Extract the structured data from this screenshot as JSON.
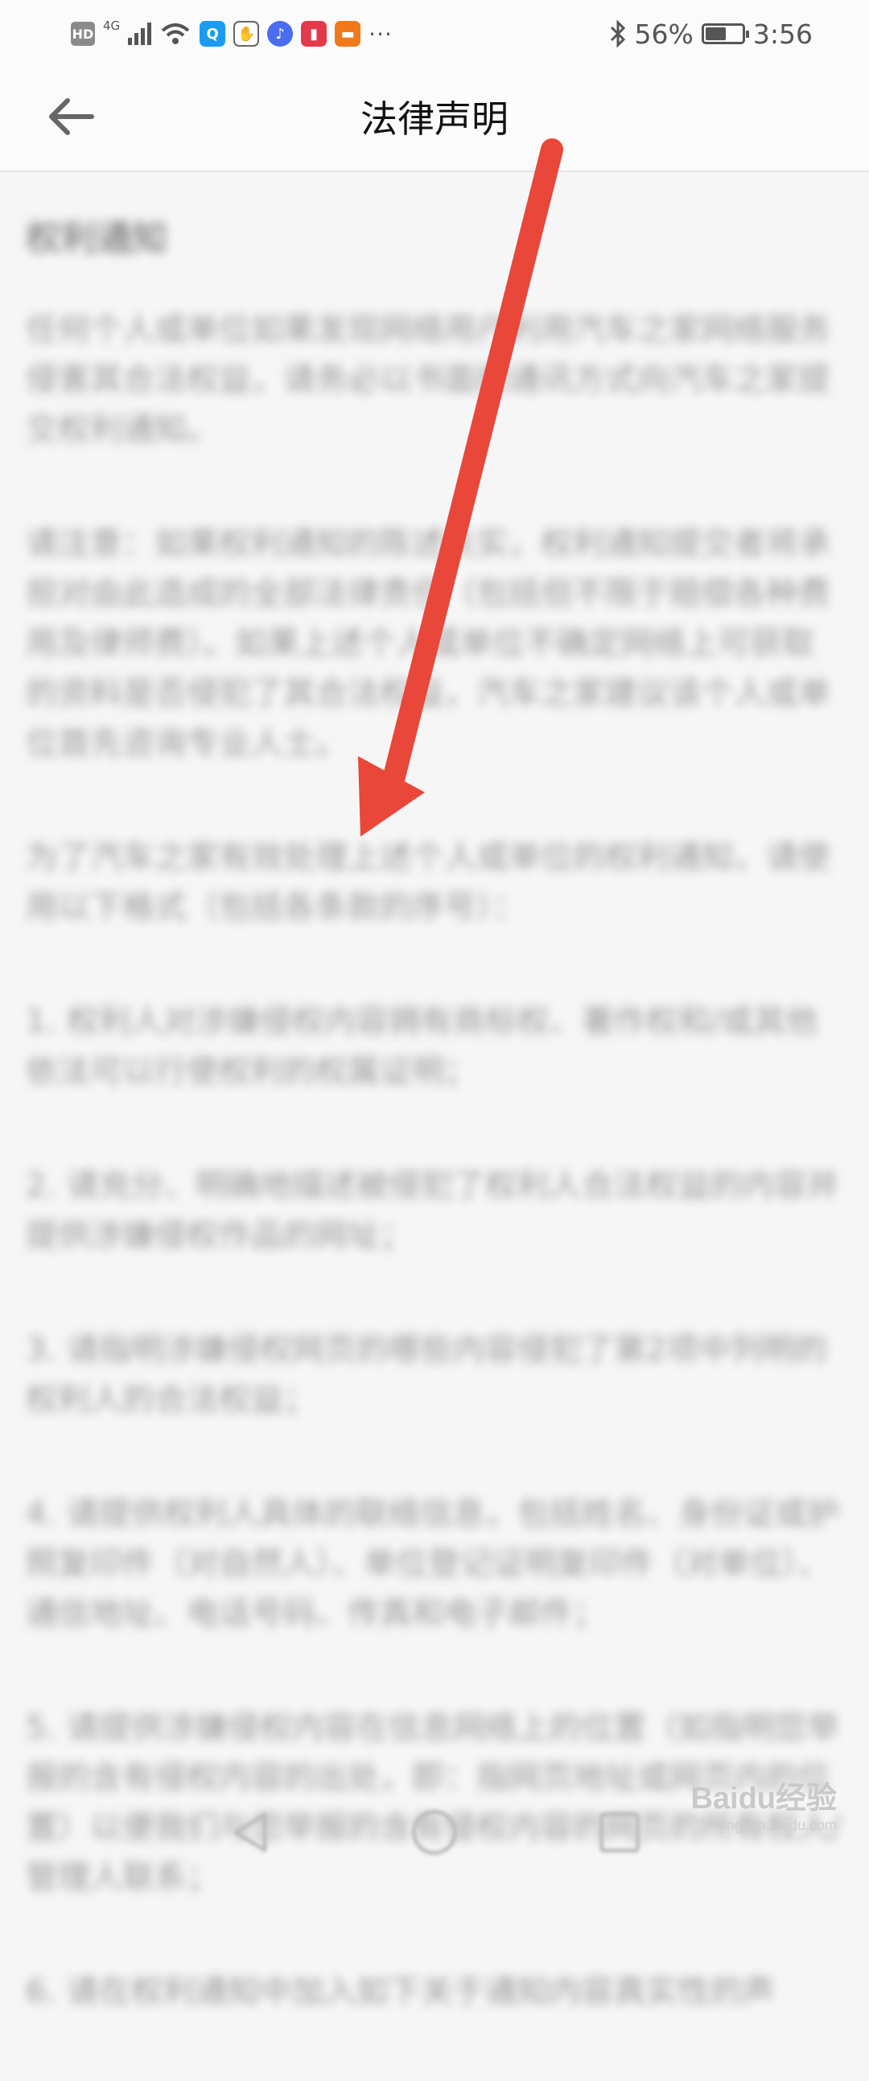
{
  "status_bar": {
    "hd": "HD",
    "network": "4G",
    "battery_percent": "56%",
    "battery_level": 0.56,
    "time": "3:56",
    "more": "···",
    "icons": [
      "signal-icon",
      "wifi-icon",
      "search-app-icon",
      "hand-app-icon",
      "music-app-icon",
      "book-app-icon",
      "news-app-icon",
      "bluetooth-icon",
      "battery-icon"
    ]
  },
  "header": {
    "title": "法律声明",
    "back_icon": "back-arrow-icon"
  },
  "content": {
    "heading": "权利通知",
    "paragraphs": [
      "任何个人或单位如果发现网络用户利用汽车之家网络服务侵害其合法权益，请务必以书面的通讯方式向汽车之家提交权利通知。",
      "请注意：如果权利通知的陈述失实，权利通知提交者将承担对由此造成的全部法律责任（包括但不限于赔偿各种费用及律师费）。如果上述个人或单位不确定网络上可获取的资料是否侵犯了其合法权益，汽车之家建议该个人或单位首先咨询专业人士。",
      "为了汽车之家有效处理上述个人或单位的权利通知，请使用以下格式（包括各条款的序号）：",
      "1. 权利人对涉嫌侵权内容拥有商标权、著作权和/或其他依法可以行使权利的权属证明；",
      "2. 请充分、明确地描述被侵犯了权利人合法权益的内容并提供涉嫌侵权作品的网址；",
      "3. 请指明涉嫌侵权网页的哪些内容侵犯了第2项中列明的权利人的合法权益；",
      "4. 请提供权利人具体的联络信息，包括姓名、身份证或护照复印件（对自然人）、单位登记证明复印件（对单位）、通信地址、电话号码、传真和电子邮件；",
      "5. 请提供涉嫌侵权内容在信息网络上的位置（如指明您举报的含有侵权内容的出处，即：指网页地址或网页内的位置）以便我们与您举报的含有侵权内容的网页的所有权人/管理人联系；",
      "6. 请在权利通知中加入如下关于通知内容真实性的声"
    ]
  },
  "nav_bar": {
    "back": "triangle-back-icon",
    "home": "circle-home-icon",
    "recent": "square-recent-icon"
  },
  "watermark": {
    "text": "Baidu经验",
    "sub": "jingyan.baidu.com"
  },
  "annotation": {
    "color": "#e8473a"
  }
}
